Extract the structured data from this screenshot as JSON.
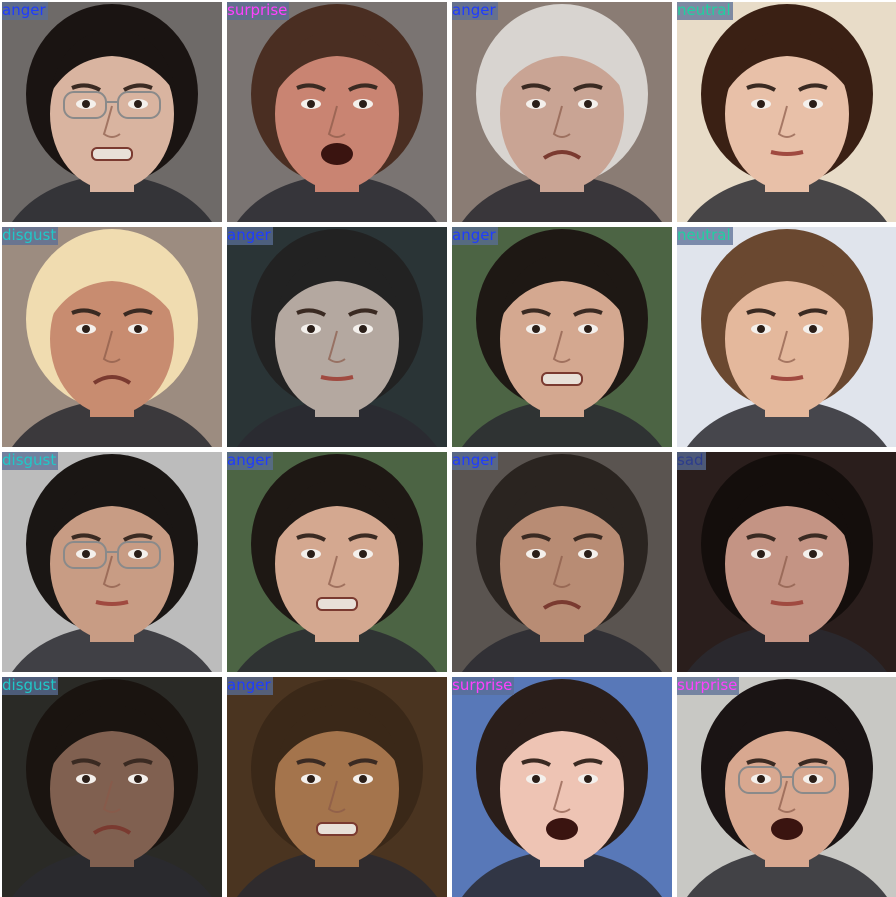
{
  "grid": {
    "tiles": [
      {
        "label": "anger",
        "label_color": "#1e3cff",
        "skin": "#d9b4a0",
        "hair": "#1a1412",
        "bg": "#6e6a68",
        "glasses": true,
        "mouth": "grimace"
      },
      {
        "label": "surprise",
        "label_color": "#ff40ff",
        "skin": "#c98472",
        "hair": "#4a2e22",
        "bg": "#7a7472",
        "glasses": false,
        "mouth": "open"
      },
      {
        "label": "anger",
        "label_color": "#1e3cff",
        "skin": "#c9a494",
        "hair": "#d8d4d0",
        "bg": "#8a7c74",
        "glasses": false,
        "mouth": "frown"
      },
      {
        "label": "neutral",
        "label_color": "#20d0a0",
        "skin": "#e8c0a8",
        "hair": "#3a2014",
        "bg": "#e8dcc8",
        "glasses": false,
        "mouth": "neutral"
      },
      {
        "label": "disgust",
        "label_color": "#20c8c8",
        "skin": "#c88c70",
        "hair": "#f0dcb0",
        "bg": "#9c8c80",
        "glasses": false,
        "mouth": "frown"
      },
      {
        "label": "anger",
        "label_color": "#1e3cff",
        "skin": "#b4a8a0",
        "hair": "#222222",
        "bg": "#2a3436",
        "glasses": false,
        "mouth": "neutral"
      },
      {
        "label": "anger",
        "label_color": "#1e3cff",
        "skin": "#d4a890",
        "hair": "#1e1814",
        "bg": "#4c6444",
        "glasses": false,
        "mouth": "grimace"
      },
      {
        "label": "neutral",
        "label_color": "#20d0a0",
        "skin": "#e4b89c",
        "hair": "#6a4830",
        "bg": "#e0e4ec",
        "glasses": false,
        "mouth": "neutral"
      },
      {
        "label": "disgust",
        "label_color": "#20c8c8",
        "skin": "#c89c84",
        "hair": "#1a1614",
        "bg": "#bcbcbc",
        "glasses": true,
        "mouth": "neutral"
      },
      {
        "label": "anger",
        "label_color": "#1e3cff",
        "skin": "#d4a890",
        "hair": "#1e1814",
        "bg": "#4c6444",
        "glasses": false,
        "mouth": "grimace"
      },
      {
        "label": "anger",
        "label_color": "#1e3cff",
        "skin": "#b88c74",
        "hair": "#2a2420",
        "bg": "#5a5450",
        "glasses": false,
        "mouth": "frown"
      },
      {
        "label": "sad",
        "label_color": "#2c3c8c",
        "skin": "#c49484",
        "hair": "#140e0c",
        "bg": "#2a1e1c",
        "glasses": false,
        "mouth": "neutral"
      },
      {
        "label": "disgust",
        "label_color": "#20c8c8",
        "skin": "#806050",
        "hair": "#1a1410",
        "bg": "#2a2a26",
        "glasses": false,
        "mouth": "frown"
      },
      {
        "label": "anger",
        "label_color": "#1e3cff",
        "skin": "#a4744c",
        "hair": "#3a2818",
        "bg": "#4a3420",
        "glasses": false,
        "mouth": "grimace"
      },
      {
        "label": "surprise",
        "label_color": "#ff40ff",
        "skin": "#eec4b4",
        "hair": "#2a1e1a",
        "bg": "#5878b8",
        "glasses": false,
        "mouth": "open"
      },
      {
        "label": "surprise",
        "label_color": "#ff40ff",
        "skin": "#d8a890",
        "hair": "#1a1414",
        "bg": "#c8c8c4",
        "glasses": true,
        "mouth": "open"
      }
    ]
  }
}
